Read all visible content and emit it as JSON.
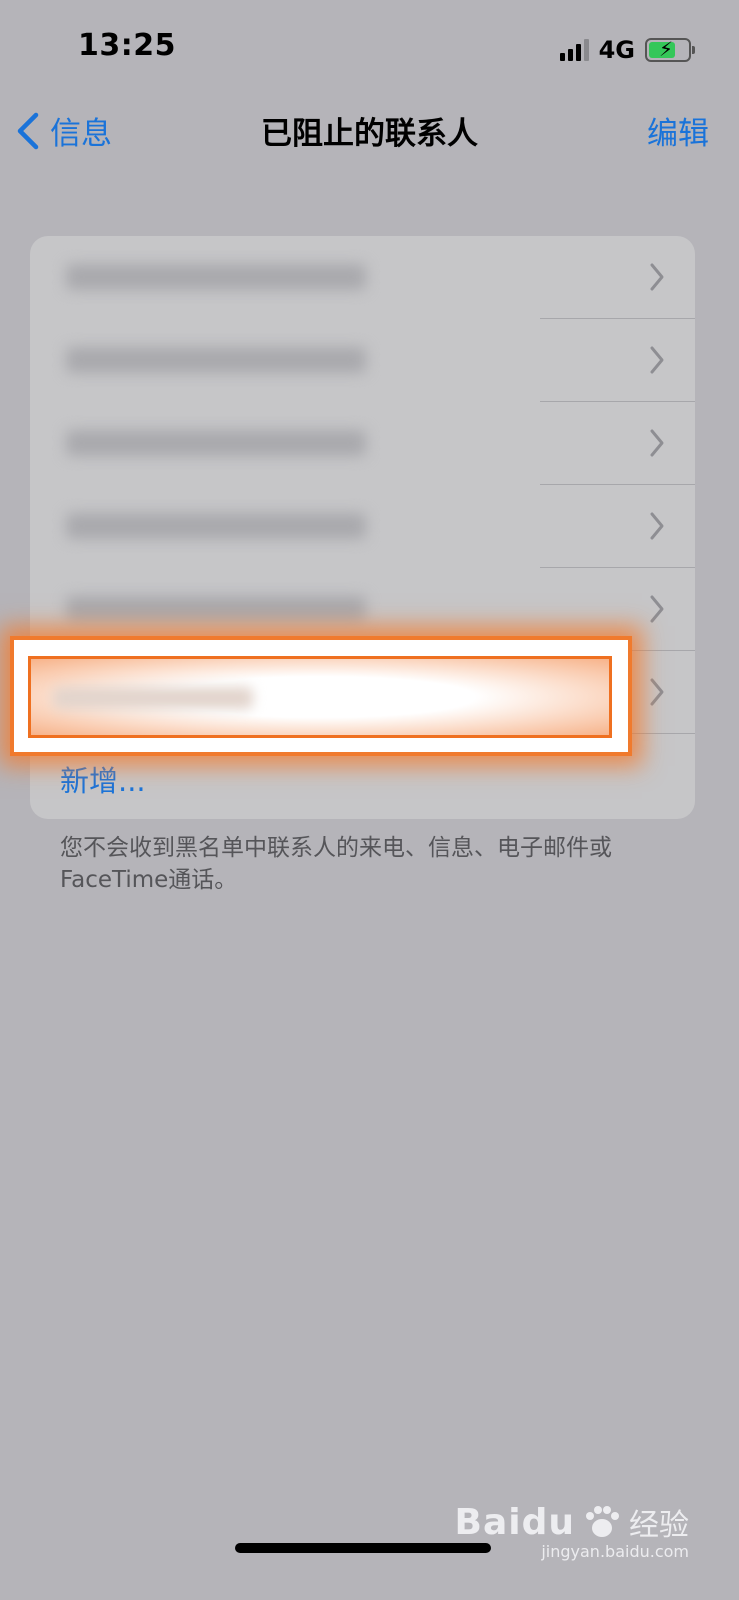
{
  "status_bar": {
    "time": "13:25",
    "network": "4G",
    "battery_charging": true
  },
  "nav": {
    "back_label": "信息",
    "title": "已阻止的联系人",
    "edit_label": "编辑"
  },
  "blocked_list": {
    "rows": [
      {
        "redacted": true
      },
      {
        "redacted": true
      },
      {
        "redacted": true
      },
      {
        "redacted": true
      },
      {
        "redacted": true
      },
      {
        "redacted": true,
        "highlighted": true
      }
    ],
    "add_label": "新增..."
  },
  "footnote": "您不会收到黑名单中联系人的来电、信息、电子邮件或FaceTime通话。",
  "watermark": {
    "logo": "Baidu",
    "suffix": "经验",
    "url": "jingyan.baidu.com"
  },
  "colors": {
    "accent": "#1a73d9",
    "highlight": "#f07a2d",
    "background": "#b5b4b9"
  }
}
